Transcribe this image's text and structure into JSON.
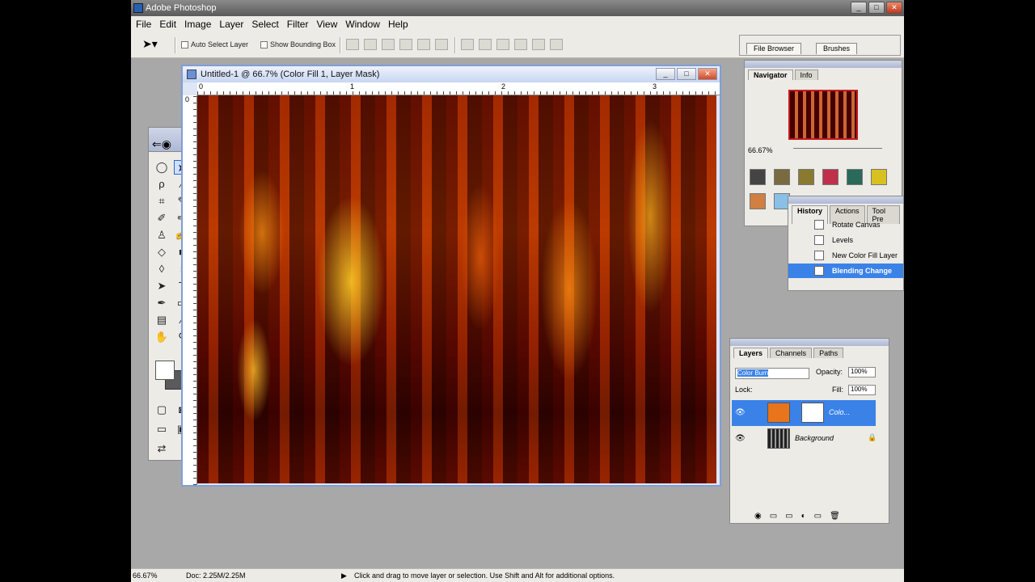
{
  "app": {
    "title": "Adobe Photoshop"
  },
  "menu": [
    "File",
    "Edit",
    "Image",
    "Layer",
    "Select",
    "Filter",
    "View",
    "Window",
    "Help"
  ],
  "options": {
    "auto_select": "Auto Select Layer",
    "show_bounding": "Show Bounding Box"
  },
  "well_tabs": [
    "File Browser",
    "Brushes"
  ],
  "document": {
    "title": "Untitled-1 @ 66.7% (Color Fill 1, Layer Mask)",
    "ruler_marks": [
      "0",
      "1",
      "2",
      "3"
    ],
    "ruler_v_mark": "0"
  },
  "navigator": {
    "tabs": [
      "Navigator",
      "Info"
    ],
    "zoom": "66.67%"
  },
  "history": {
    "tabs": [
      "History",
      "Actions",
      "Tool Pre"
    ],
    "items": [
      "Rotate Canvas",
      "Levels",
      "New Color Fill Layer",
      "Blending Change"
    ]
  },
  "layers": {
    "tabs": [
      "Layers",
      "Channels",
      "Paths"
    ],
    "blend_mode": "Color Burn",
    "opacity_label": "Opacity:",
    "opacity": "100%",
    "lock_label": "Lock:",
    "fill_label": "Fill:",
    "fill": "100%",
    "rows": [
      {
        "name": "Colo...",
        "active": true
      },
      {
        "name": "Background",
        "active": false
      }
    ]
  },
  "status": {
    "zoom": "66.67%",
    "doc": "Doc: 2.25M/2.25M",
    "hint": "Click and drag to move layer or selection.  Use Shift and Alt for additional options."
  },
  "colors": {
    "accent": "#3a82e8",
    "layer_fill": "#e8741c"
  }
}
